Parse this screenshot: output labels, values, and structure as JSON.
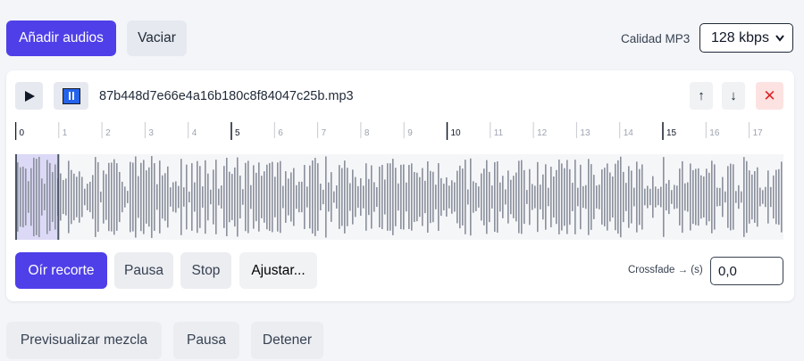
{
  "toolbar": {
    "add_label": "Añadir audios",
    "clear_label": "Vaciar",
    "quality_label": "Calidad MP3",
    "quality_value": "128 kbps"
  },
  "track": {
    "file_name": "87b448d7e66e4a16b180c8f84047c25b.mp3",
    "up_label": "↑",
    "down_label": "↓",
    "remove_label": "✕",
    "ruler_ticks": [
      "0",
      "1",
      "2",
      "3",
      "4",
      "5",
      "6",
      "7",
      "8",
      "9",
      "10",
      "11",
      "12",
      "13",
      "14",
      "15",
      "16",
      "17"
    ],
    "selection_seconds": [
      0,
      1
    ],
    "actions": {
      "listen_label": "Oír recorte",
      "pause_label": "Pausa",
      "stop_label": "Stop",
      "adjust_label": "Ajustar..."
    },
    "crossfade_label": "Crossfade → (s)",
    "crossfade_value": "0,0"
  },
  "mix": {
    "preview_label": "Previsualizar mezcla",
    "pause_label": "Pausa",
    "stop_label": "Detener"
  },
  "colors": {
    "primary": "#4f3fe8",
    "waveform": "#8a909c",
    "selection": "#dcd9f6",
    "remove_bg": "#fde2e2",
    "remove_fg": "#dc2626"
  }
}
